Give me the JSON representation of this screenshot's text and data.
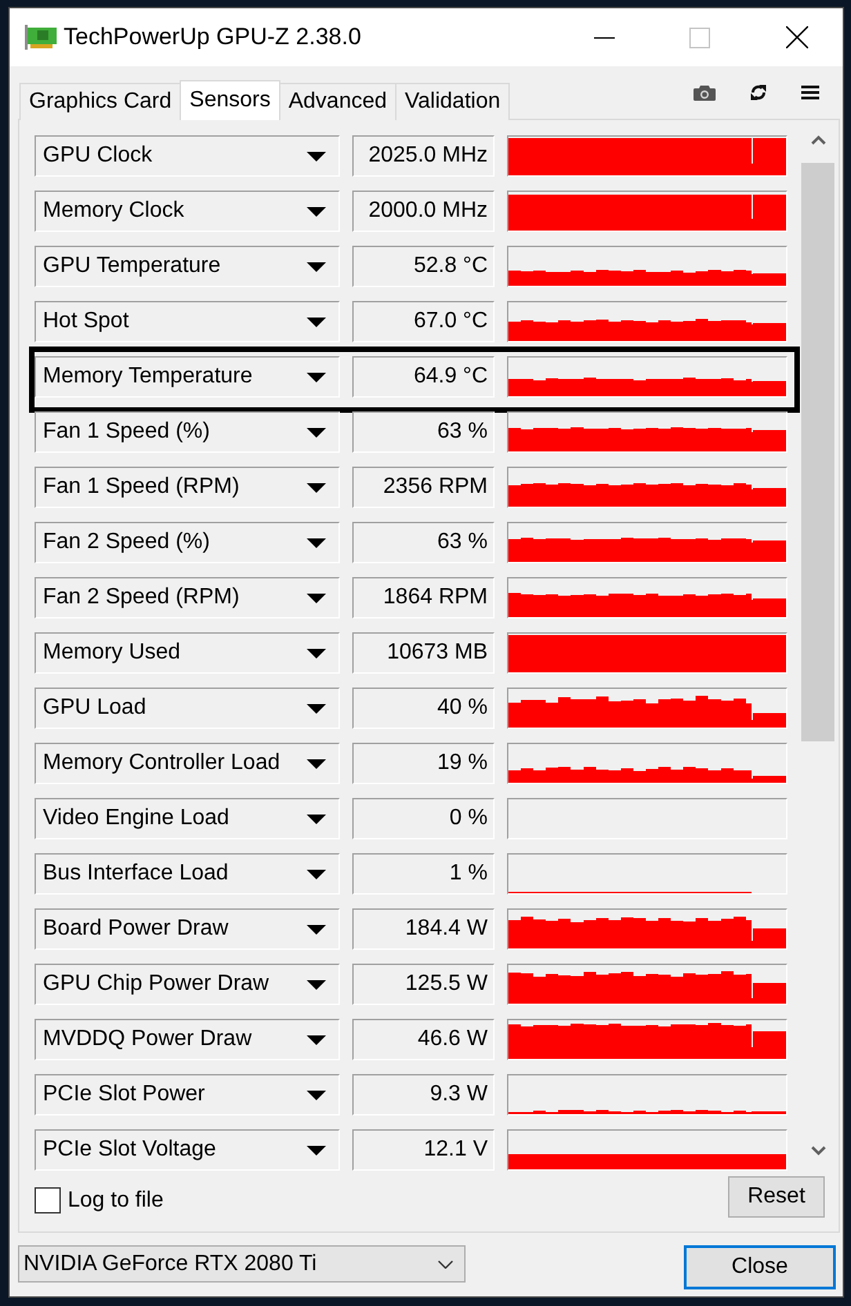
{
  "window": {
    "title": "TechPowerUp GPU-Z 2.38.0",
    "maximize_disabled": true
  },
  "tabs": [
    {
      "label": "Graphics Card",
      "selected": false
    },
    {
      "label": "Sensors",
      "selected": true
    },
    {
      "label": "Advanced",
      "selected": false
    },
    {
      "label": "Validation",
      "selected": false
    }
  ],
  "sensors": [
    {
      "name": "GPU Clock",
      "value": "2025.0 MHz",
      "highlighted": false
    },
    {
      "name": "Memory Clock",
      "value": "2000.0 MHz",
      "highlighted": false
    },
    {
      "name": "GPU Temperature",
      "value": "52.8 °C",
      "highlighted": false
    },
    {
      "name": "Hot Spot",
      "value": "67.0 °C",
      "highlighted": false
    },
    {
      "name": "Memory Temperature",
      "value": "64.9 °C",
      "highlighted": true
    },
    {
      "name": "Fan 1 Speed (%)",
      "value": "63 %",
      "highlighted": false
    },
    {
      "name": "Fan 1 Speed (RPM)",
      "value": "2356 RPM",
      "highlighted": false
    },
    {
      "name": "Fan 2 Speed (%)",
      "value": "63 %",
      "highlighted": false
    },
    {
      "name": "Fan 2 Speed (RPM)",
      "value": "1864 RPM",
      "highlighted": false
    },
    {
      "name": "Memory Used",
      "value": "10673 MB",
      "highlighted": false
    },
    {
      "name": "GPU Load",
      "value": "40 %",
      "highlighted": false
    },
    {
      "name": "Memory Controller Load",
      "value": "19 %",
      "highlighted": false
    },
    {
      "name": "Video Engine Load",
      "value": "0 %",
      "highlighted": false
    },
    {
      "name": "Bus Interface Load",
      "value": "1 %",
      "highlighted": false
    },
    {
      "name": "Board Power Draw",
      "value": "184.4 W",
      "highlighted": false
    },
    {
      "name": "GPU Chip Power Draw",
      "value": "125.5 W",
      "highlighted": false
    },
    {
      "name": "MVDDQ Power Draw",
      "value": "46.6 W",
      "highlighted": false
    },
    {
      "name": "PCIe Slot Power",
      "value": "9.3 W",
      "highlighted": false
    },
    {
      "name": "PCIe Slot Voltage",
      "value": "12.1 V",
      "highlighted": false
    }
  ],
  "log_to_file": {
    "label": "Log to file",
    "checked": false
  },
  "reset_button": {
    "label": "Reset",
    "focused": false
  },
  "gpu_select": {
    "value": "NVIDIA GeForce RTX 2080 Ti"
  },
  "close_button": {
    "label": "Close",
    "focused": true
  }
}
